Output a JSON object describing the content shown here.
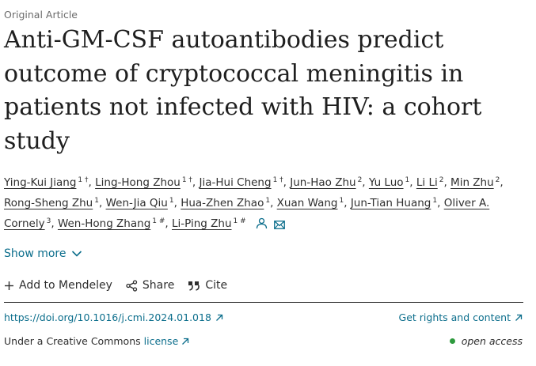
{
  "article_type": "Original Article",
  "title": "Anti-GM-CSF autoantibodies predict outcome of cryptococcal meningitis in patients not infected with HIV: a cohort study",
  "authors": [
    {
      "name": "Ying-Kui Jiang",
      "sup": "1 †",
      "sep": ","
    },
    {
      "name": "Ling-Hong Zhou",
      "sup": "1 †",
      "sep": ","
    },
    {
      "name": "Jia-Hui Cheng",
      "sup": "1 †",
      "sep": ","
    },
    {
      "name": "Jun-Hao Zhu",
      "sup": "2",
      "sep": ","
    },
    {
      "name": "Yu Luo",
      "sup": "1",
      "sep": ","
    },
    {
      "name": "Li Li",
      "sup": "2",
      "sep": ","
    },
    {
      "name": "Min Zhu",
      "sup": "2",
      "sep": ","
    },
    {
      "name": "Rong-Sheng Zhu",
      "sup": "1",
      "sep": ","
    },
    {
      "name": "Wen-Jia Qiu",
      "sup": "1",
      "sep": ","
    },
    {
      "name": "Hua-Zhen Zhao",
      "sup": "1",
      "sep": ","
    },
    {
      "name": "Xuan Wang",
      "sup": "1",
      "sep": ","
    },
    {
      "name": "Jun-Tian Huang",
      "sup": "1",
      "sep": ","
    },
    {
      "name": "Oliver A. Cornely",
      "sup": "3",
      "sep": ","
    },
    {
      "name": "Wen-Hong Zhang",
      "sup": "1 #",
      "sep": ","
    },
    {
      "name": "Li-Ping Zhu",
      "sup": "1 #",
      "sep": ""
    }
  ],
  "show_more": "Show more",
  "actions": {
    "mendeley": "Add to Mendeley",
    "share": "Share",
    "cite": "Cite"
  },
  "doi": "https://doi.org/10.1016/j.cmi.2024.01.018",
  "rights": "Get rights and content",
  "license_prefix": "Under a Creative Commons",
  "license_link": "license",
  "open_access": "open access",
  "colors": {
    "link": "#0c6e8c",
    "text": "#2e2e2e",
    "open_access_dot": "#2e9a3e"
  }
}
